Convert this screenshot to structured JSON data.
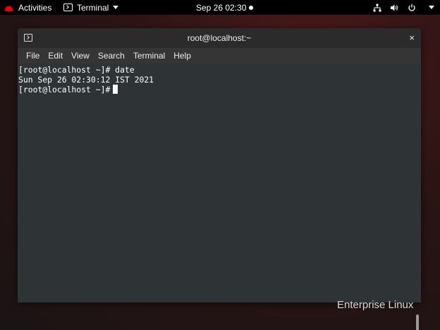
{
  "topbar": {
    "activities_label": "Activities",
    "app_label": "Terminal",
    "clock": "Sep 26  02:30"
  },
  "window": {
    "title": "root@localhost:~",
    "close_glyph": "×"
  },
  "menu": {
    "items": [
      "File",
      "Edit",
      "View",
      "Search",
      "Terminal",
      "Help"
    ]
  },
  "terminal": {
    "lines": [
      "[root@localhost ~]# date",
      "Sun Sep 26 02:30:12 IST 2021",
      "[root@localhost ~]#"
    ]
  },
  "desktop": {
    "brand_text": "Enterprise Linux"
  },
  "colors": {
    "terminal_bg": "#2e3436",
    "titlebar_bg": "#2b2b2b",
    "topbar_bg": "#000000",
    "redhat_red": "#ee0000"
  }
}
